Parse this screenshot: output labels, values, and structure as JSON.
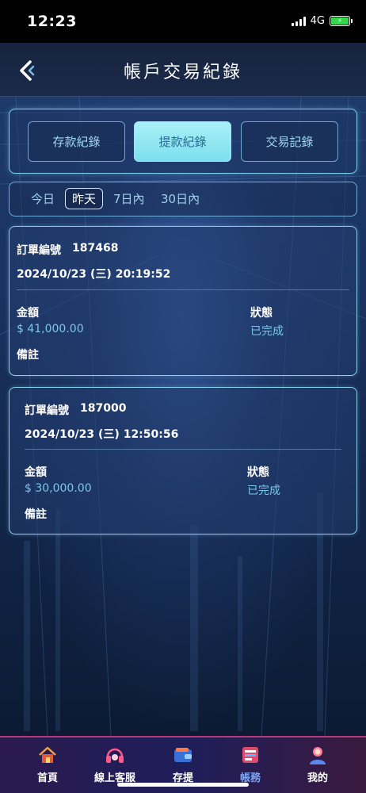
{
  "status_bar": {
    "time": "12:23",
    "network": "4G"
  },
  "header": {
    "title": "帳戶交易紀錄"
  },
  "tabs": [
    {
      "label": "存款紀錄",
      "active": false
    },
    {
      "label": "提款紀錄",
      "active": true
    },
    {
      "label": "交易記錄",
      "active": false
    }
  ],
  "date_filters": [
    {
      "label": "今日",
      "active": false
    },
    {
      "label": "昨天",
      "active": true
    },
    {
      "label": "7日內",
      "active": false
    },
    {
      "label": "30日內",
      "active": false
    }
  ],
  "records": [
    {
      "order_label": "訂單編號",
      "order_no": "187468",
      "datetime": "2024/10/23 (三) 20:19:52",
      "amount_label": "金額",
      "amount": "$ 41,000.00",
      "status_label": "狀態",
      "status": "已完成",
      "note_label": "備註"
    },
    {
      "order_label": "訂單編號",
      "order_no": "187000",
      "datetime": "2024/10/23 (三) 12:50:56",
      "amount_label": "金額",
      "amount": "$ 30,000.00",
      "status_label": "狀態",
      "status": "已完成",
      "note_label": "備註"
    }
  ],
  "bottom_nav": [
    {
      "label": "首頁",
      "icon": "home-icon",
      "active": false
    },
    {
      "label": "線上客服",
      "icon": "headset-icon",
      "active": false
    },
    {
      "label": "存提",
      "icon": "wallet-icon",
      "active": false
    },
    {
      "label": "帳務",
      "icon": "ledger-icon",
      "active": true
    },
    {
      "label": "我的",
      "icon": "user-icon",
      "active": false
    }
  ],
  "colors": {
    "accent": "#7de0ee",
    "value_text": "#7cc6ea",
    "nav_active": "#7aa6f5"
  }
}
